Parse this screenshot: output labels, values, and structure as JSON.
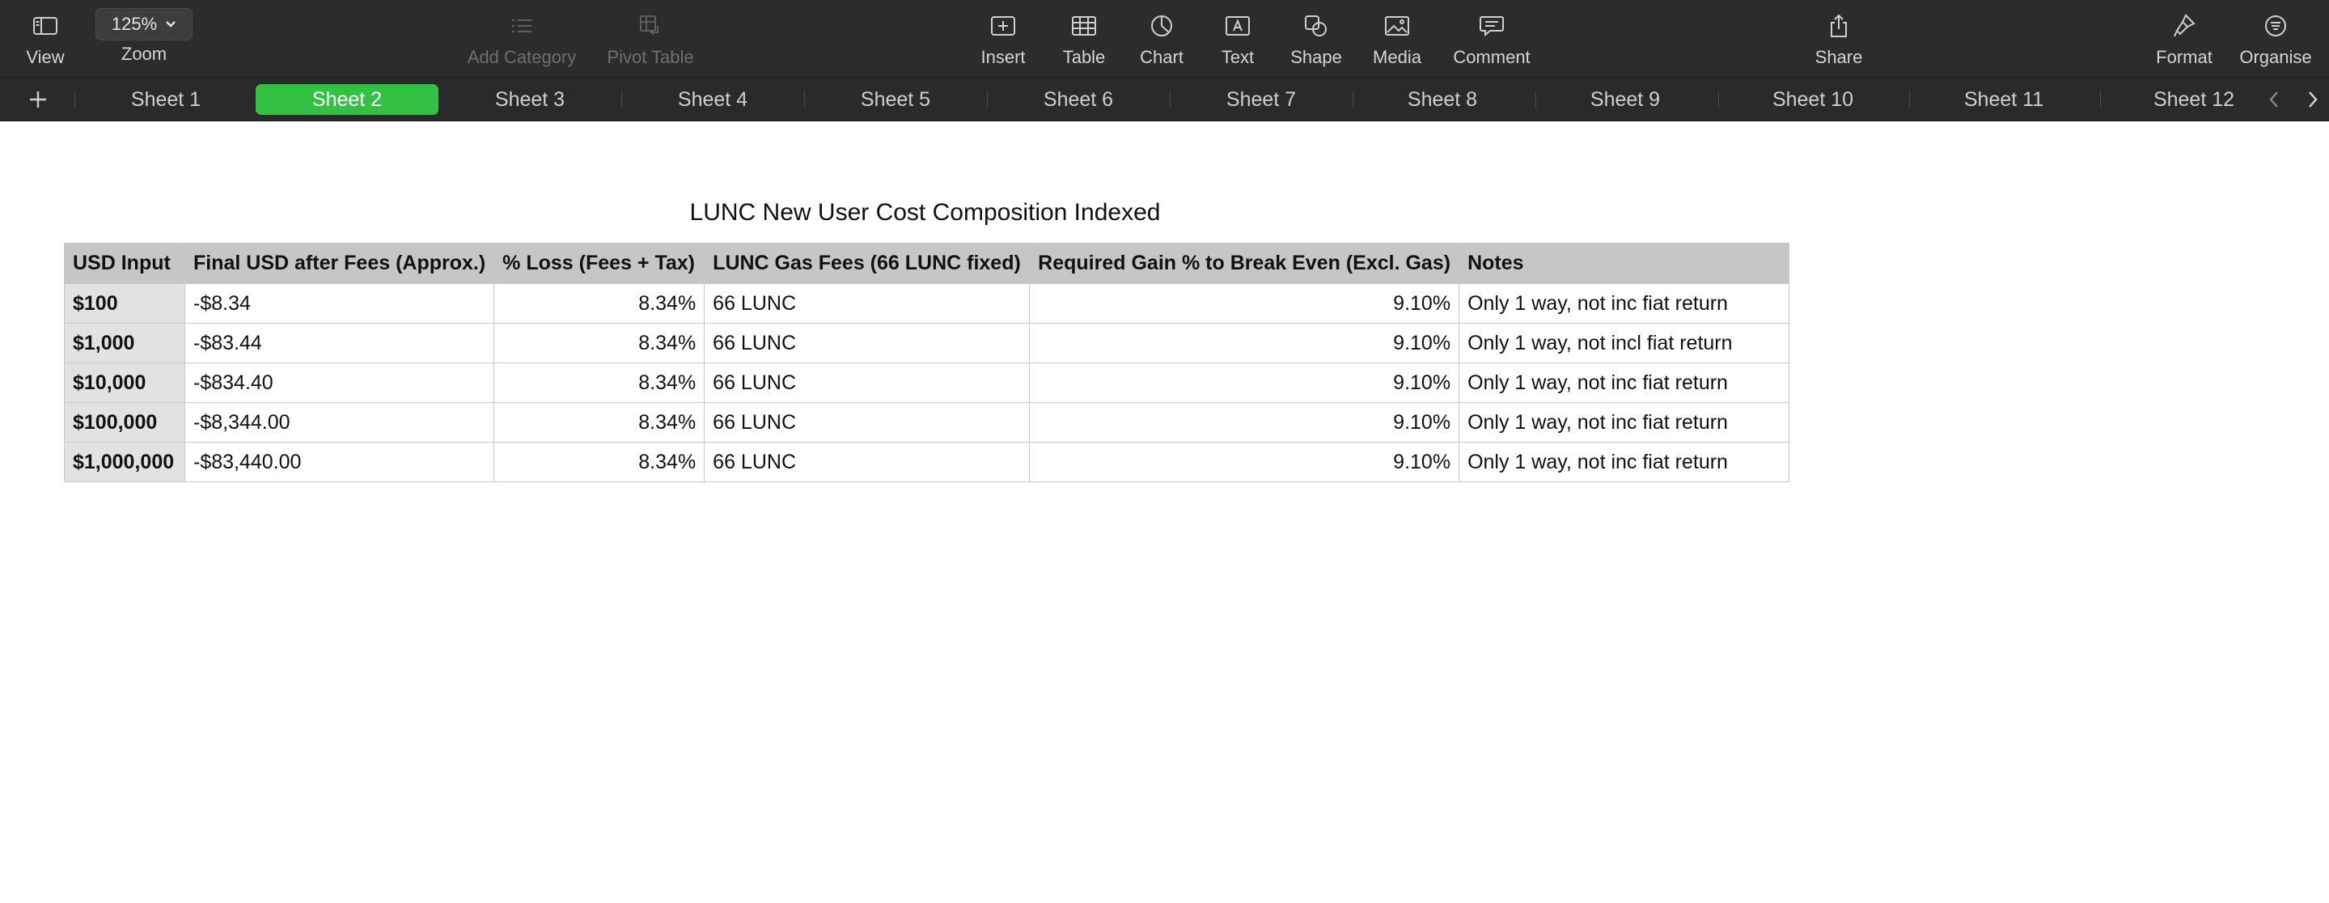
{
  "toolbar": {
    "view_label": "View",
    "zoom_value": "125%",
    "zoom_label": "Zoom",
    "add_category_label": "Add Category",
    "pivot_table_label": "Pivot Table",
    "insert_label": "Insert",
    "table_label": "Table",
    "chart_label": "Chart",
    "text_label": "Text",
    "shape_label": "Shape",
    "media_label": "Media",
    "comment_label": "Comment",
    "share_label": "Share",
    "format_label": "Format",
    "organise_label": "Organise"
  },
  "tabs": {
    "add_symbol": "+",
    "items": [
      "Sheet 1",
      "Sheet 2",
      "Sheet 3",
      "Sheet 4",
      "Sheet 5",
      "Sheet 6",
      "Sheet 7",
      "Sheet 8",
      "Sheet 9",
      "Sheet 10",
      "Sheet 11",
      "Sheet 12"
    ],
    "active": "Sheet 2",
    "active_color": "#33c144"
  },
  "table": {
    "title": "LUNC New User Cost Composition Indexed",
    "headers": [
      "USD Input",
      "Final USD after Fees (Approx.)",
      "% Loss (Fees + Tax)",
      "LUNC Gas Fees (66 LUNC fixed)",
      "Required Gain % to Break Even (Excl. Gas)",
      "Notes"
    ],
    "rows": [
      [
        "$100",
        "-$8.34",
        "8.34%",
        "66 LUNC",
        "9.10%",
        "Only 1 way, not inc fiat return"
      ],
      [
        "$1,000",
        "-$83.44",
        "8.34%",
        "66 LUNC",
        "9.10%",
        "Only 1 way, not incl fiat return"
      ],
      [
        "$10,000",
        "-$834.40",
        "8.34%",
        "66 LUNC",
        "9.10%",
        "Only 1 way, not inc fiat return"
      ],
      [
        "$100,000",
        "-$8,344.00",
        "8.34%",
        "66 LUNC",
        "9.10%",
        "Only 1 way, not inc fiat return"
      ],
      [
        "$1,000,000",
        "-$83,440.00",
        "8.34%",
        "66 LUNC",
        "9.10%",
        "Only 1 way, not inc fiat return"
      ]
    ]
  }
}
